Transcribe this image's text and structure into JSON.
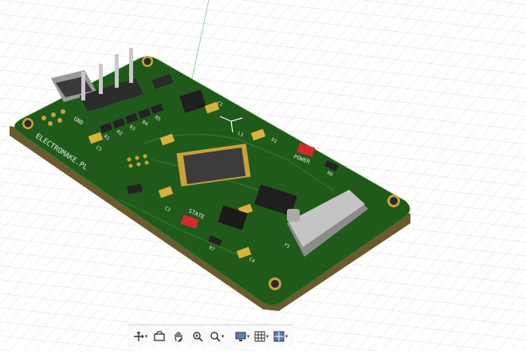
{
  "board": {
    "brand_text": "ELECTROMAKE.PL",
    "silk_labels": {
      "gnd": "GND",
      "power": "POWER",
      "state": "STATE",
      "r1": "R1",
      "r2": "R2",
      "r3": "R3",
      "r4": "R4",
      "r5": "R5",
      "r6": "R6",
      "r7": "R7",
      "c1": "C1",
      "c3": "C3",
      "c4": "C4",
      "c5": "C5",
      "d1": "D1",
      "l1": "L1",
      "y1": "Y1"
    },
    "colors": {
      "pcb": "#1f5a1a",
      "pcb_edge": "#6b5a2e",
      "copper_pad": "#c8a23a",
      "led": "#d42a2a"
    }
  },
  "toolbar": {
    "items": [
      {
        "name": "orbit-icon",
        "has_menu": true
      },
      {
        "name": "look-at-icon",
        "has_menu": false
      },
      {
        "name": "pan-icon",
        "has_menu": false
      },
      {
        "name": "zoom-icon",
        "has_menu": false
      },
      {
        "name": "fit-icon",
        "has_menu": true
      },
      {
        "name": "display-settings-icon",
        "has_menu": true
      },
      {
        "name": "grid-icon",
        "has_menu": true
      },
      {
        "name": "viewports-icon",
        "has_menu": true
      }
    ]
  }
}
